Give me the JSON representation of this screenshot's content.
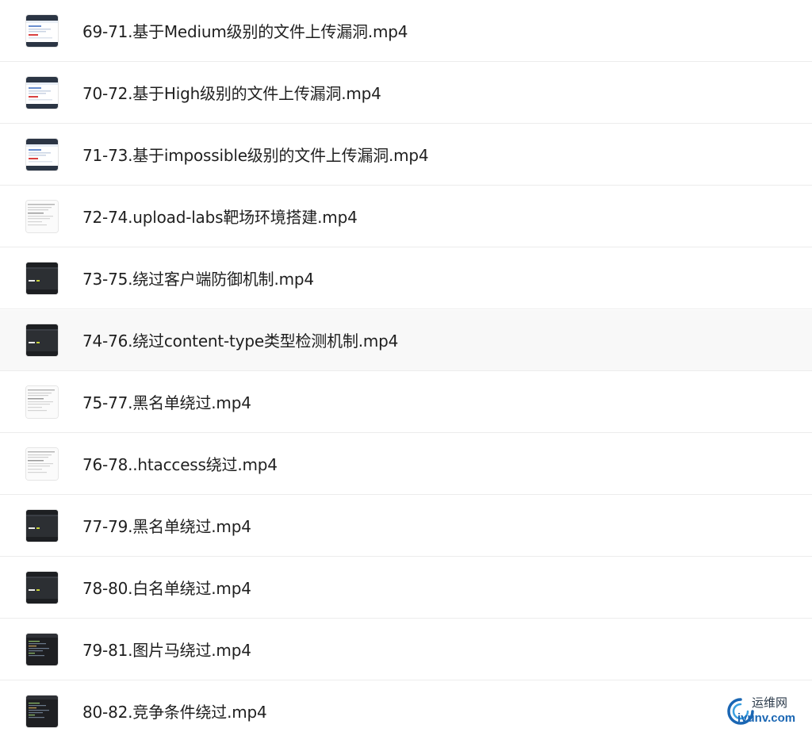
{
  "files": [
    {
      "name": "69-71.基于Medium级别的文件上传漏洞.mp4",
      "thumb": "light-browser"
    },
    {
      "name": "70-72.基于High级别的文件上传漏洞.mp4",
      "thumb": "light-browser"
    },
    {
      "name": "71-73.基于impossible级别的文件上传漏洞.mp4",
      "thumb": "light-browser"
    },
    {
      "name": "72-74.upload-labs靶场环境搭建.mp4",
      "thumb": "light-document"
    },
    {
      "name": "73-75.绕过客户端防御机制.mp4",
      "thumb": "dark-app"
    },
    {
      "name": "74-76.绕过content-type类型检测机制.mp4",
      "thumb": "dark-app"
    },
    {
      "name": "75-77.黑名单绕过.mp4",
      "thumb": "light-document"
    },
    {
      "name": "76-78..htaccess绕过.mp4",
      "thumb": "light-document"
    },
    {
      "name": "77-79.黑名单绕过.mp4",
      "thumb": "dark-app"
    },
    {
      "name": "78-80.白名单绕过.mp4",
      "thumb": "dark-app"
    },
    {
      "name": "79-81.图片马绕过.mp4",
      "thumb": "dark-terminal"
    },
    {
      "name": "80-82.竞争条件绕过.mp4",
      "thumb": "dark-terminal"
    }
  ],
  "hovered_index": 5,
  "watermark": {
    "cn": "运维网",
    "en": "iyunv.com"
  },
  "colors": {
    "text": "#1f1f1f",
    "divider": "#ececec",
    "hover_bg": "#f8f8f8",
    "watermark_blue": "#1a66b3"
  }
}
